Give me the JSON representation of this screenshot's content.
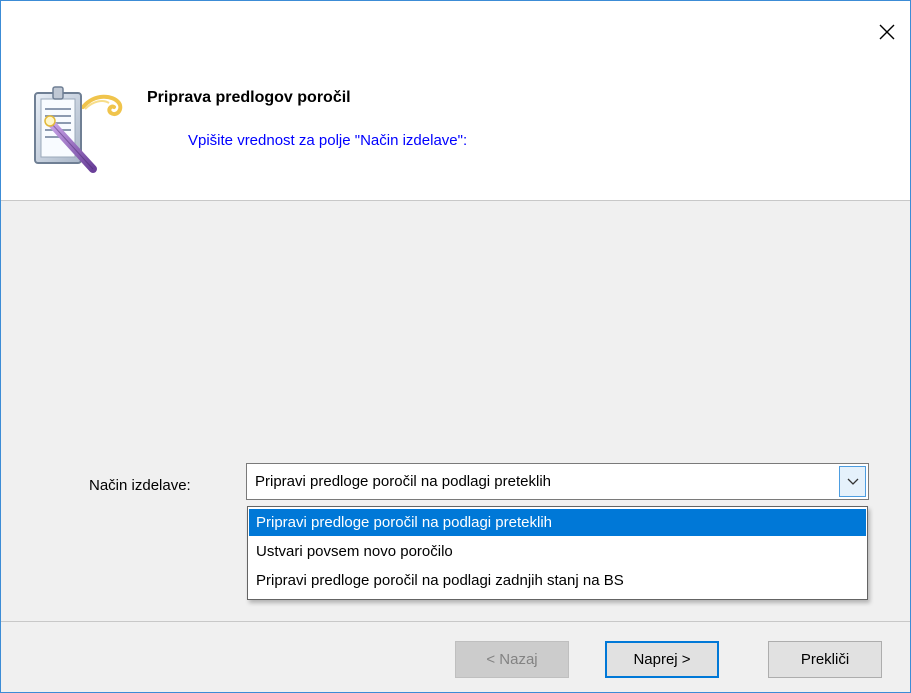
{
  "window": {
    "close_icon": "close-icon",
    "wizard_icon": "report-wizard-icon"
  },
  "header": {
    "title": "Priprava predlogov poročil",
    "subtitle": "Vpišite vrednost za polje \"Način izdelave\":"
  },
  "field": {
    "label": "Način izdelave:",
    "value": "Pripravi predloge poročil na podlagi preteklih",
    "options": [
      "Pripravi predloge poročil na podlagi preteklih",
      "Ustvari povsem novo poročilo",
      "Pripravi predloge poročil na podlagi zadnjih stanj na BS"
    ],
    "selected_index": 0
  },
  "buttons": {
    "back": "< Nazaj",
    "next": "Naprej >",
    "cancel": "Prekliči"
  },
  "colors": {
    "accent": "#0078d7",
    "subtitle_text": "#0000ff",
    "window_border": "#3c8cd6"
  }
}
